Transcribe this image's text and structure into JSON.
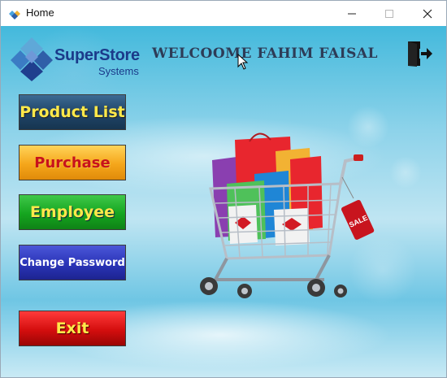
{
  "window": {
    "title": "Home"
  },
  "brand": {
    "name": "SuperStore",
    "sub": "Systems",
    "colors": {
      "primary": "#1b3a8a",
      "diamond": "#2f5fa8"
    }
  },
  "header": {
    "welcome": "WELCOOME FAHIM FAISAL"
  },
  "menu": {
    "product_list": "Product List",
    "purchase": "Purchase",
    "employee": "Employee",
    "change_password": "Change Password",
    "exit": "Exit"
  },
  "cart": {
    "tag_text": "SALE"
  },
  "icons": [
    "app-icon",
    "minimize-icon",
    "maximize-icon",
    "close-icon",
    "logout-icon",
    "shopping-cart-illustration",
    "mouse-cursor-icon"
  ]
}
